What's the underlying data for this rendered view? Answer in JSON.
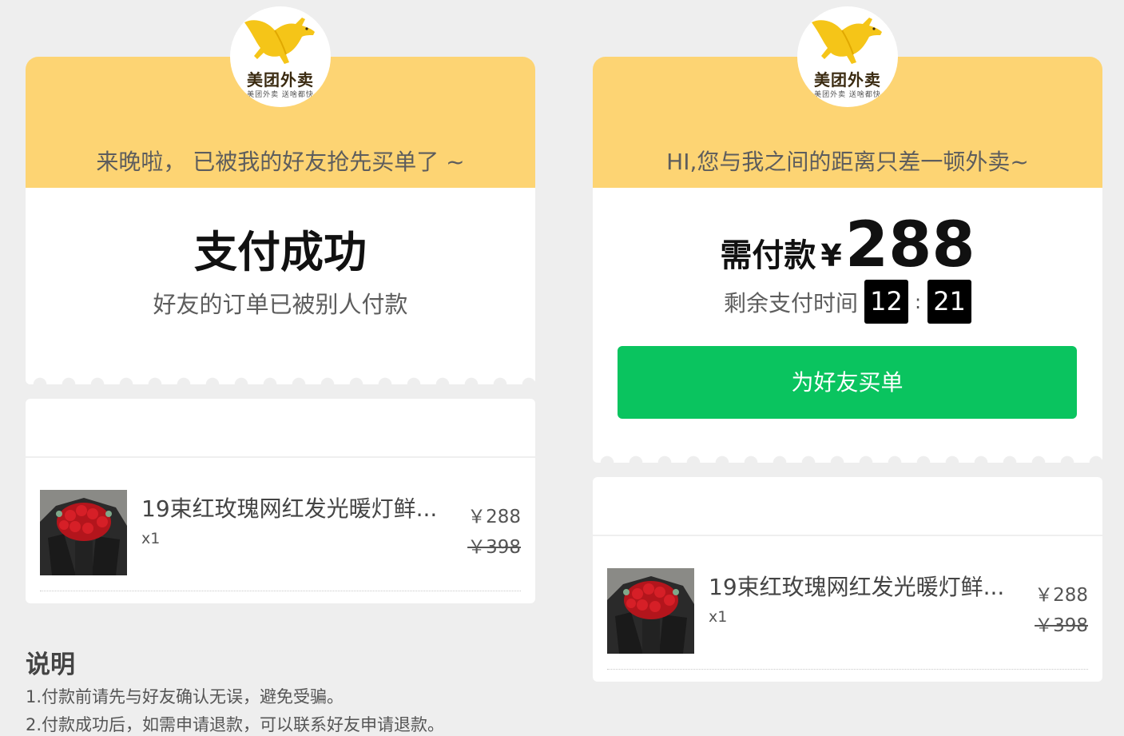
{
  "logo": {
    "title": "美团外卖",
    "subtitle": "美团外卖 送啥都快"
  },
  "left": {
    "slogan": "来晚啦， 已被我的好友抢先买单了 ~",
    "title": "支付成功",
    "subtitle": "好友的订单已被别人付款"
  },
  "right": {
    "slogan": "HI,您与我之间的距离只差一顿外卖~",
    "pay_label": "需付款",
    "currency": "¥",
    "amount": "288",
    "timer_label": "剩余支付时间",
    "timer_minutes": "12",
    "timer_separator": ":",
    "timer_seconds": "21",
    "button_label": "为好友买单"
  },
  "product": {
    "name": "19束红玫瑰网红发光暖灯鲜...",
    "qty": "x1",
    "price": "￥288",
    "original_price": "￥398"
  },
  "notes": {
    "title": "说明",
    "lines": [
      "1.付款前请先与好友确认无误，避免受骗。",
      "2.付款成功后，如需申请退款，可以联系好友申请退款。"
    ]
  },
  "colors": {
    "header_yellow": "#fdd473",
    "button_green": "#0ac45f",
    "page_background": "#eeeeee"
  }
}
